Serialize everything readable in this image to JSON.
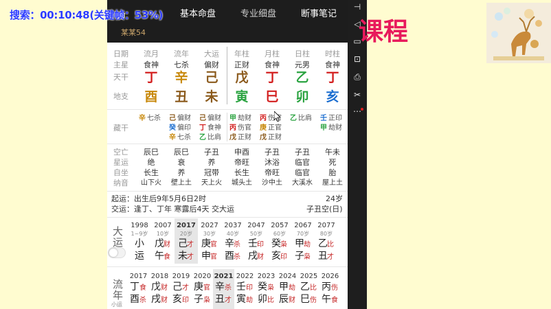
{
  "overlay": {
    "timer": "搜索：00:10:48(关键帧：53%)"
  },
  "desktop": {
    "lesson_title": "课程"
  },
  "header": {
    "left_fragment": "命",
    "tabs": [
      {
        "label": "基本命盘"
      },
      {
        "label": "专业细盘"
      },
      {
        "label": "断事笔记"
      }
    ],
    "person": "某某54"
  },
  "toolbar": {
    "icons": [
      "pin-icon",
      "volume-icon",
      "screen-icon",
      "export-icon",
      "printer-icon",
      "scissors-icon",
      "more-icon"
    ]
  },
  "chart": {
    "row_labels": {
      "date": "日期",
      "main_star": "主星",
      "heaven": "天干",
      "earth": "地支",
      "hidden": "藏干",
      "kongwang": "空亡",
      "xingyun": "星运",
      "zizuo": "自坐",
      "nayin": "纳音"
    },
    "columns": [
      {
        "name": "流月",
        "star": "食神",
        "stem": "丁",
        "branch": "酉",
        "stem_el": "fire",
        "branch_el": "metal"
      },
      {
        "name": "流年",
        "star": "七杀",
        "stem": "辛",
        "branch": "丑",
        "stem_el": "metal",
        "branch_el": "earth"
      },
      {
        "name": "大运",
        "star": "偏财",
        "stem": "己",
        "branch": "未",
        "stem_el": "earth",
        "branch_el": "earth"
      },
      {
        "name": "年柱",
        "star": "正财",
        "stem": "戊",
        "branch": "寅",
        "stem_el": "earth",
        "branch_el": "wood"
      },
      {
        "name": "月柱",
        "star": "食神",
        "stem": "丁",
        "branch": "巳",
        "stem_el": "fire",
        "branch_el": "fire"
      },
      {
        "name": "日柱",
        "star": "元男",
        "stem": "乙",
        "branch": "卯",
        "stem_el": "wood",
        "branch_el": "wood"
      },
      {
        "name": "时柱",
        "star": "食神",
        "stem": "丁",
        "branch": "亥",
        "stem_el": "fire",
        "branch_el": "water"
      }
    ],
    "hidden_stems": [
      [
        {
          "g": "辛",
          "s": "七杀",
          "el": "metal"
        }
      ],
      [
        {
          "g": "己",
          "s": "偏财",
          "el": "earth"
        },
        {
          "g": "癸",
          "s": "偏印",
          "el": "water"
        },
        {
          "g": "辛",
          "s": "七杀",
          "el": "metal"
        }
      ],
      [
        {
          "g": "己",
          "s": "偏财",
          "el": "earth"
        },
        {
          "g": "丁",
          "s": "食神",
          "el": "fire"
        },
        {
          "g": "乙",
          "s": "比肩",
          "el": "wood"
        }
      ],
      [
        {
          "g": "甲",
          "s": "劫财",
          "el": "wood"
        },
        {
          "g": "丙",
          "s": "伤官",
          "el": "fire"
        },
        {
          "g": "戊",
          "s": "正财",
          "el": "earth"
        }
      ],
      [
        {
          "g": "丙",
          "s": "伤官",
          "el": "fire"
        },
        {
          "g": "庚",
          "s": "正官",
          "el": "metal"
        },
        {
          "g": "戊",
          "s": "正财",
          "el": "earth"
        }
      ],
      [
        {
          "g": "乙",
          "s": "比肩",
          "el": "wood"
        }
      ],
      [
        {
          "g": "壬",
          "s": "正印",
          "el": "water"
        },
        {
          "g": "甲",
          "s": "劫财",
          "el": "wood"
        }
      ]
    ],
    "extra_rows": [
      [
        "辰巳",
        "辰巳",
        "子丑",
        "申酉",
        "子丑",
        "子丑",
        "午未"
      ],
      [
        "绝",
        "衰",
        "养",
        "帝旺",
        "沐浴",
        "临官",
        "死"
      ],
      [
        "长生",
        "养",
        "冠带",
        "长生",
        "帝旺",
        "临官",
        "胎"
      ],
      [
        "山下火",
        "壁上土",
        "天上火",
        "城头土",
        "沙中土",
        "大溪水",
        "屋上土"
      ]
    ]
  },
  "info": {
    "qiyun_label": "起运：出生后9年5月6日2时",
    "age": "24岁",
    "jiaoyun_label": "交运：逢丁、丁年 寒露后4天 交大运",
    "kongwang": "子丑空(日)"
  },
  "dayun": {
    "label_top": "大",
    "label_bottom": "运",
    "first": {
      "year": "1998",
      "age": "1~9岁",
      "top": "小",
      "bottom": "运"
    },
    "items": [
      {
        "year": "2007",
        "age": "10岁",
        "g": "戊",
        "gs": "财",
        "z": "午",
        "zs": "食"
      },
      {
        "year": "2017",
        "age": "20岁",
        "g": "己",
        "gs": "才",
        "z": "未",
        "zs": "才"
      },
      {
        "year": "2027",
        "age": "30岁",
        "g": "庚",
        "gs": "官",
        "z": "申",
        "zs": "官"
      },
      {
        "year": "2037",
        "age": "40岁",
        "g": "辛",
        "gs": "杀",
        "z": "酉",
        "zs": "杀"
      },
      {
        "year": "2047",
        "age": "50岁",
        "g": "壬",
        "gs": "印",
        "z": "戌",
        "zs": "财"
      },
      {
        "year": "2057",
        "age": "60岁",
        "g": "癸",
        "gs": "枭",
        "z": "亥",
        "zs": "印"
      },
      {
        "year": "2067",
        "age": "70岁",
        "g": "甲",
        "gs": "劫",
        "z": "子",
        "zs": "枭"
      },
      {
        "year": "2077",
        "age": "80岁",
        "g": "乙",
        "gs": "比",
        "z": "丑",
        "zs": "才"
      }
    ]
  },
  "liunian": {
    "label_top": "流",
    "label_bottom": "年",
    "label_small": "小运",
    "items": [
      {
        "year": "2017",
        "g": "丁",
        "gs": "食",
        "z": "酉",
        "zs": "杀"
      },
      {
        "year": "2018",
        "g": "戊",
        "gs": "财",
        "z": "戌",
        "zs": "财"
      },
      {
        "year": "2019",
        "g": "己",
        "gs": "才",
        "z": "亥",
        "zs": "印"
      },
      {
        "year": "2020",
        "g": "庚",
        "gs": "官",
        "z": "子",
        "zs": "枭"
      },
      {
        "year": "2021",
        "g": "辛",
        "gs": "杀",
        "z": "丑",
        "zs": "才"
      },
      {
        "year": "2022",
        "g": "壬",
        "gs": "印",
        "z": "寅",
        "zs": "劫"
      },
      {
        "year": "2023",
        "g": "癸",
        "gs": "枭",
        "z": "卯",
        "zs": "比"
      },
      {
        "year": "2024",
        "g": "甲",
        "gs": "劫",
        "z": "辰",
        "zs": "财"
      },
      {
        "year": "2025",
        "g": "乙",
        "gs": "比",
        "z": "巳",
        "zs": "伤"
      },
      {
        "year": "2026",
        "g": "丙",
        "gs": "伤",
        "z": "午",
        "zs": "食"
      }
    ]
  },
  "colors": {
    "fire": "#d31f1f",
    "metal": "#c8890c",
    "earth": "#8b5a1c",
    "wood": "#2aa340",
    "water": "#1e6fd0"
  }
}
